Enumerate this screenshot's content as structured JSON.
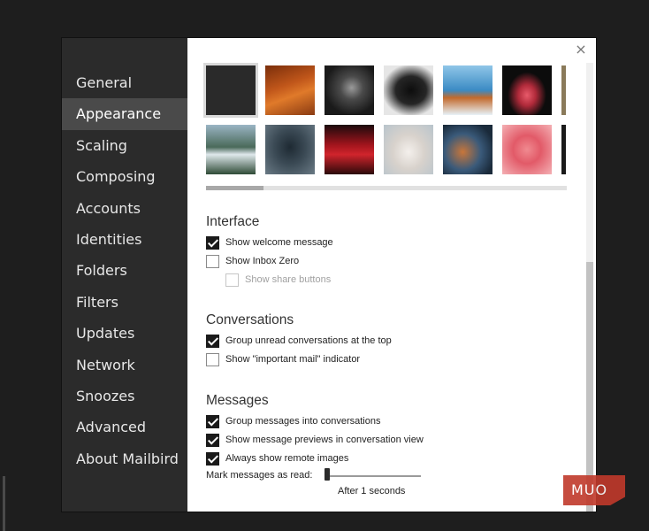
{
  "sidebar": {
    "items": [
      {
        "label": "General",
        "active": false
      },
      {
        "label": "Appearance",
        "active": true
      },
      {
        "label": "Scaling",
        "active": false
      },
      {
        "label": "Composing",
        "active": false
      },
      {
        "label": "Accounts",
        "active": false
      },
      {
        "label": "Identities",
        "active": false
      },
      {
        "label": "Folders",
        "active": false
      },
      {
        "label": "Filters",
        "active": false
      },
      {
        "label": "Updates",
        "active": false
      },
      {
        "label": "Network",
        "active": false
      },
      {
        "label": "Snoozes",
        "active": false
      },
      {
        "label": "Advanced",
        "active": false
      },
      {
        "label": "About Mailbird",
        "active": false
      }
    ]
  },
  "dialog": {
    "close_icon": "×"
  },
  "backgrounds": {
    "row1": [
      "solid-dark",
      "autumn-forest",
      "astronaut",
      "black-dog",
      "dog-on-beach",
      "flamingo-dark",
      "partial-image"
    ],
    "row2": [
      "waterfall-bridge",
      "dragon-map",
      "red-interior",
      "white-kitten",
      "cat-bokeh",
      "pink-flamingo",
      "partial-image"
    ],
    "selected_index": 0
  },
  "interface": {
    "title": "Interface",
    "show_welcome": {
      "label": "Show welcome message",
      "checked": true
    },
    "show_inbox_zero": {
      "label": "Show Inbox Zero",
      "checked": false
    },
    "show_share": {
      "label": "Show share buttons",
      "checked": false,
      "disabled": true
    }
  },
  "conversations": {
    "title": "Conversations",
    "group_unread": {
      "label": "Group unread conversations at the top",
      "checked": true
    },
    "important_mail": {
      "label": "Show \"important mail\" indicator",
      "checked": false
    }
  },
  "messages": {
    "title": "Messages",
    "group_messages": {
      "label": "Group messages into conversations",
      "checked": true
    },
    "previews": {
      "label": "Show message previews in conversation view",
      "checked": true
    },
    "remote_images": {
      "label": "Always show remote images",
      "checked": true
    },
    "mark_read_label": "Mark messages as read:",
    "mark_read_value": "After 1 seconds"
  },
  "watermark": "MUO",
  "colors": {
    "sidebar_bg": "#2b2b2b",
    "sidebar_active": "#4a4a4a",
    "checkbox_checked": "#1a1a1a",
    "watermark": "#c0392b"
  }
}
